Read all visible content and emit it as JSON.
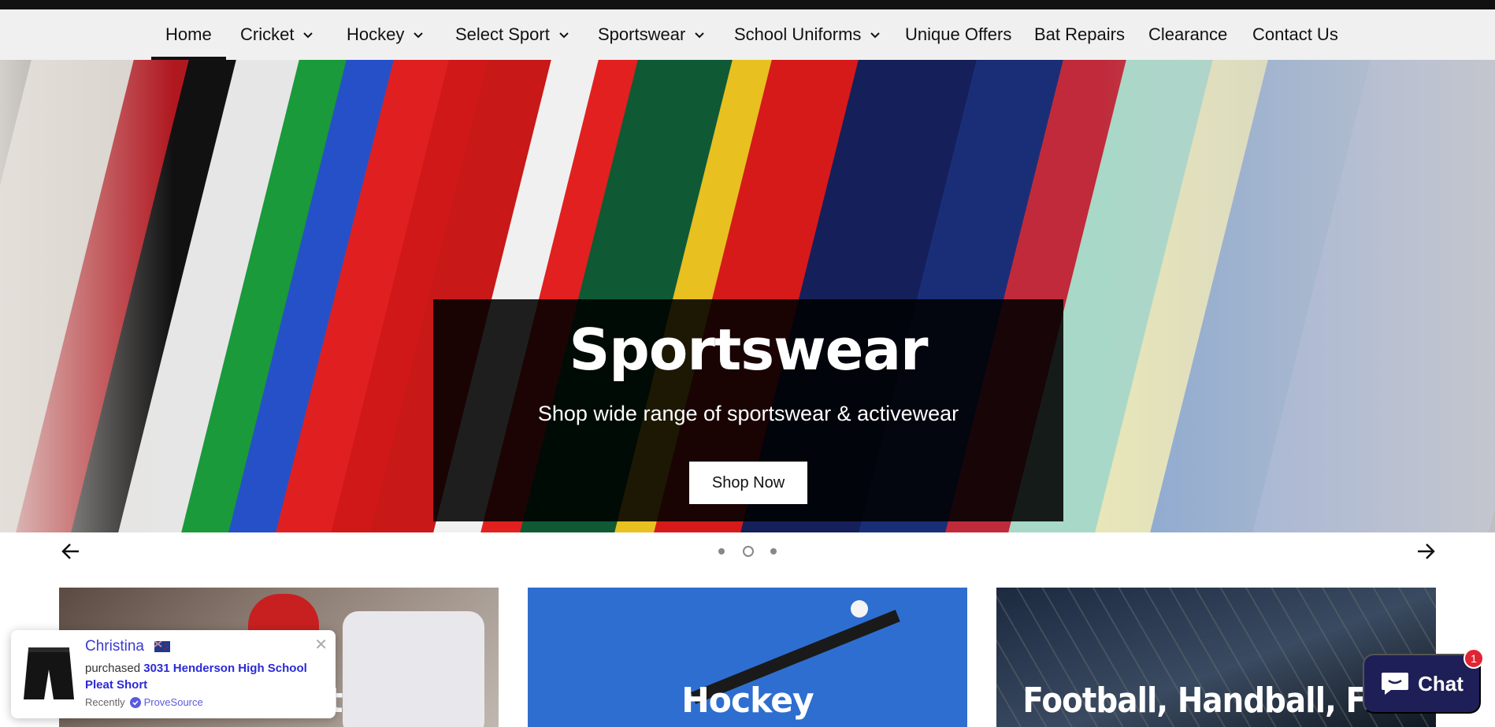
{
  "nav": {
    "items": [
      {
        "label": "Home",
        "has_dropdown": false,
        "active": true
      },
      {
        "label": "Cricket",
        "has_dropdown": true
      },
      {
        "label": "Hockey",
        "has_dropdown": true
      },
      {
        "label": "Select Sport",
        "has_dropdown": true
      },
      {
        "label": "Sportswear",
        "has_dropdown": true
      },
      {
        "label": "School Uniforms",
        "has_dropdown": true
      },
      {
        "label": "Unique Offers",
        "has_dropdown": false
      },
      {
        "label": "Bat Repairs",
        "has_dropdown": false
      },
      {
        "label": "Clearance",
        "has_dropdown": false
      },
      {
        "label": "Contact Us",
        "has_dropdown": false
      }
    ]
  },
  "hero": {
    "title": "Sportswear",
    "subtitle": "Shop wide range of sportswear & activewear",
    "button_label": "Shop Now",
    "slide_count": 3,
    "active_slide": 2
  },
  "categories": [
    {
      "label": "Cricket"
    },
    {
      "label": "Hockey"
    },
    {
      "label": "Football, Handball, Futsal"
    }
  ],
  "popup": {
    "name": "Christina",
    "purchase_prefix": "purchased",
    "product": "3031 Henderson High School Pleat Short",
    "time": "Recently",
    "source": "ProveSource"
  },
  "chat": {
    "label": "Chat",
    "badge": "1"
  },
  "colors": {
    "nav_bg": "#f0f0f0",
    "accent_link": "#2a2ad8",
    "chat_bg": "#1f1f57",
    "badge": "#e02433"
  }
}
